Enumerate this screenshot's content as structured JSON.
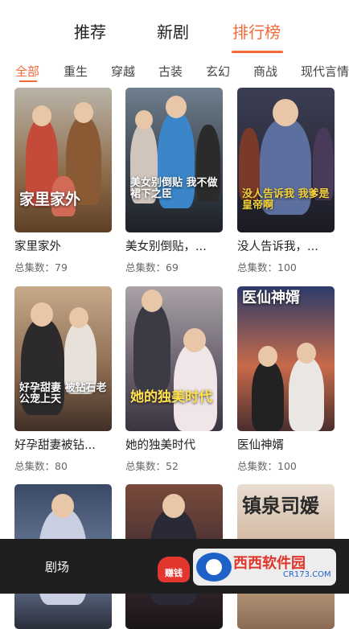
{
  "top_tabs": [
    {
      "label": "推荐",
      "active": false
    },
    {
      "label": "新剧",
      "active": false
    },
    {
      "label": "排行榜",
      "active": true
    }
  ],
  "categories": [
    "全部",
    "重生",
    "穿越",
    "古装",
    "玄幻",
    "商战",
    "现代言情"
  ],
  "active_category": "全部",
  "accent_color": "#f26a3a",
  "episodes_prefix": "总集数：",
  "dramas": [
    {
      "title": "家里家外",
      "episodes": "79",
      "poster_caption": "家里家外"
    },
    {
      "title": "美女别倒贴，...",
      "episodes": "69",
      "poster_caption": "美女别倒贴 我不做裙下之臣"
    },
    {
      "title": "没人告诉我，...",
      "episodes": "100",
      "poster_caption": "没人告诉我 我爹是皇帝啊"
    },
    {
      "title": "好孕甜妻被钻...",
      "episodes": "80",
      "poster_caption": "好孕甜妻 被钻石老公宠上天"
    },
    {
      "title": "她的独美时代",
      "episodes": "52",
      "poster_caption": "她的独美时代"
    },
    {
      "title": "医仙神婿",
      "episodes": "100",
      "poster_caption": "医仙神婿"
    },
    {
      "title": "",
      "episodes": "",
      "poster_caption": ""
    },
    {
      "title": "",
      "episodes": "",
      "poster_caption": ""
    },
    {
      "title": "",
      "episodes": "",
      "poster_caption": "镇泉司媛"
    }
  ],
  "bottom_nav": {
    "theater_label": "剧场",
    "earn_label": "赚钱"
  },
  "watermark": {
    "brand": "西西软件园",
    "url": "CR173.COM"
  }
}
